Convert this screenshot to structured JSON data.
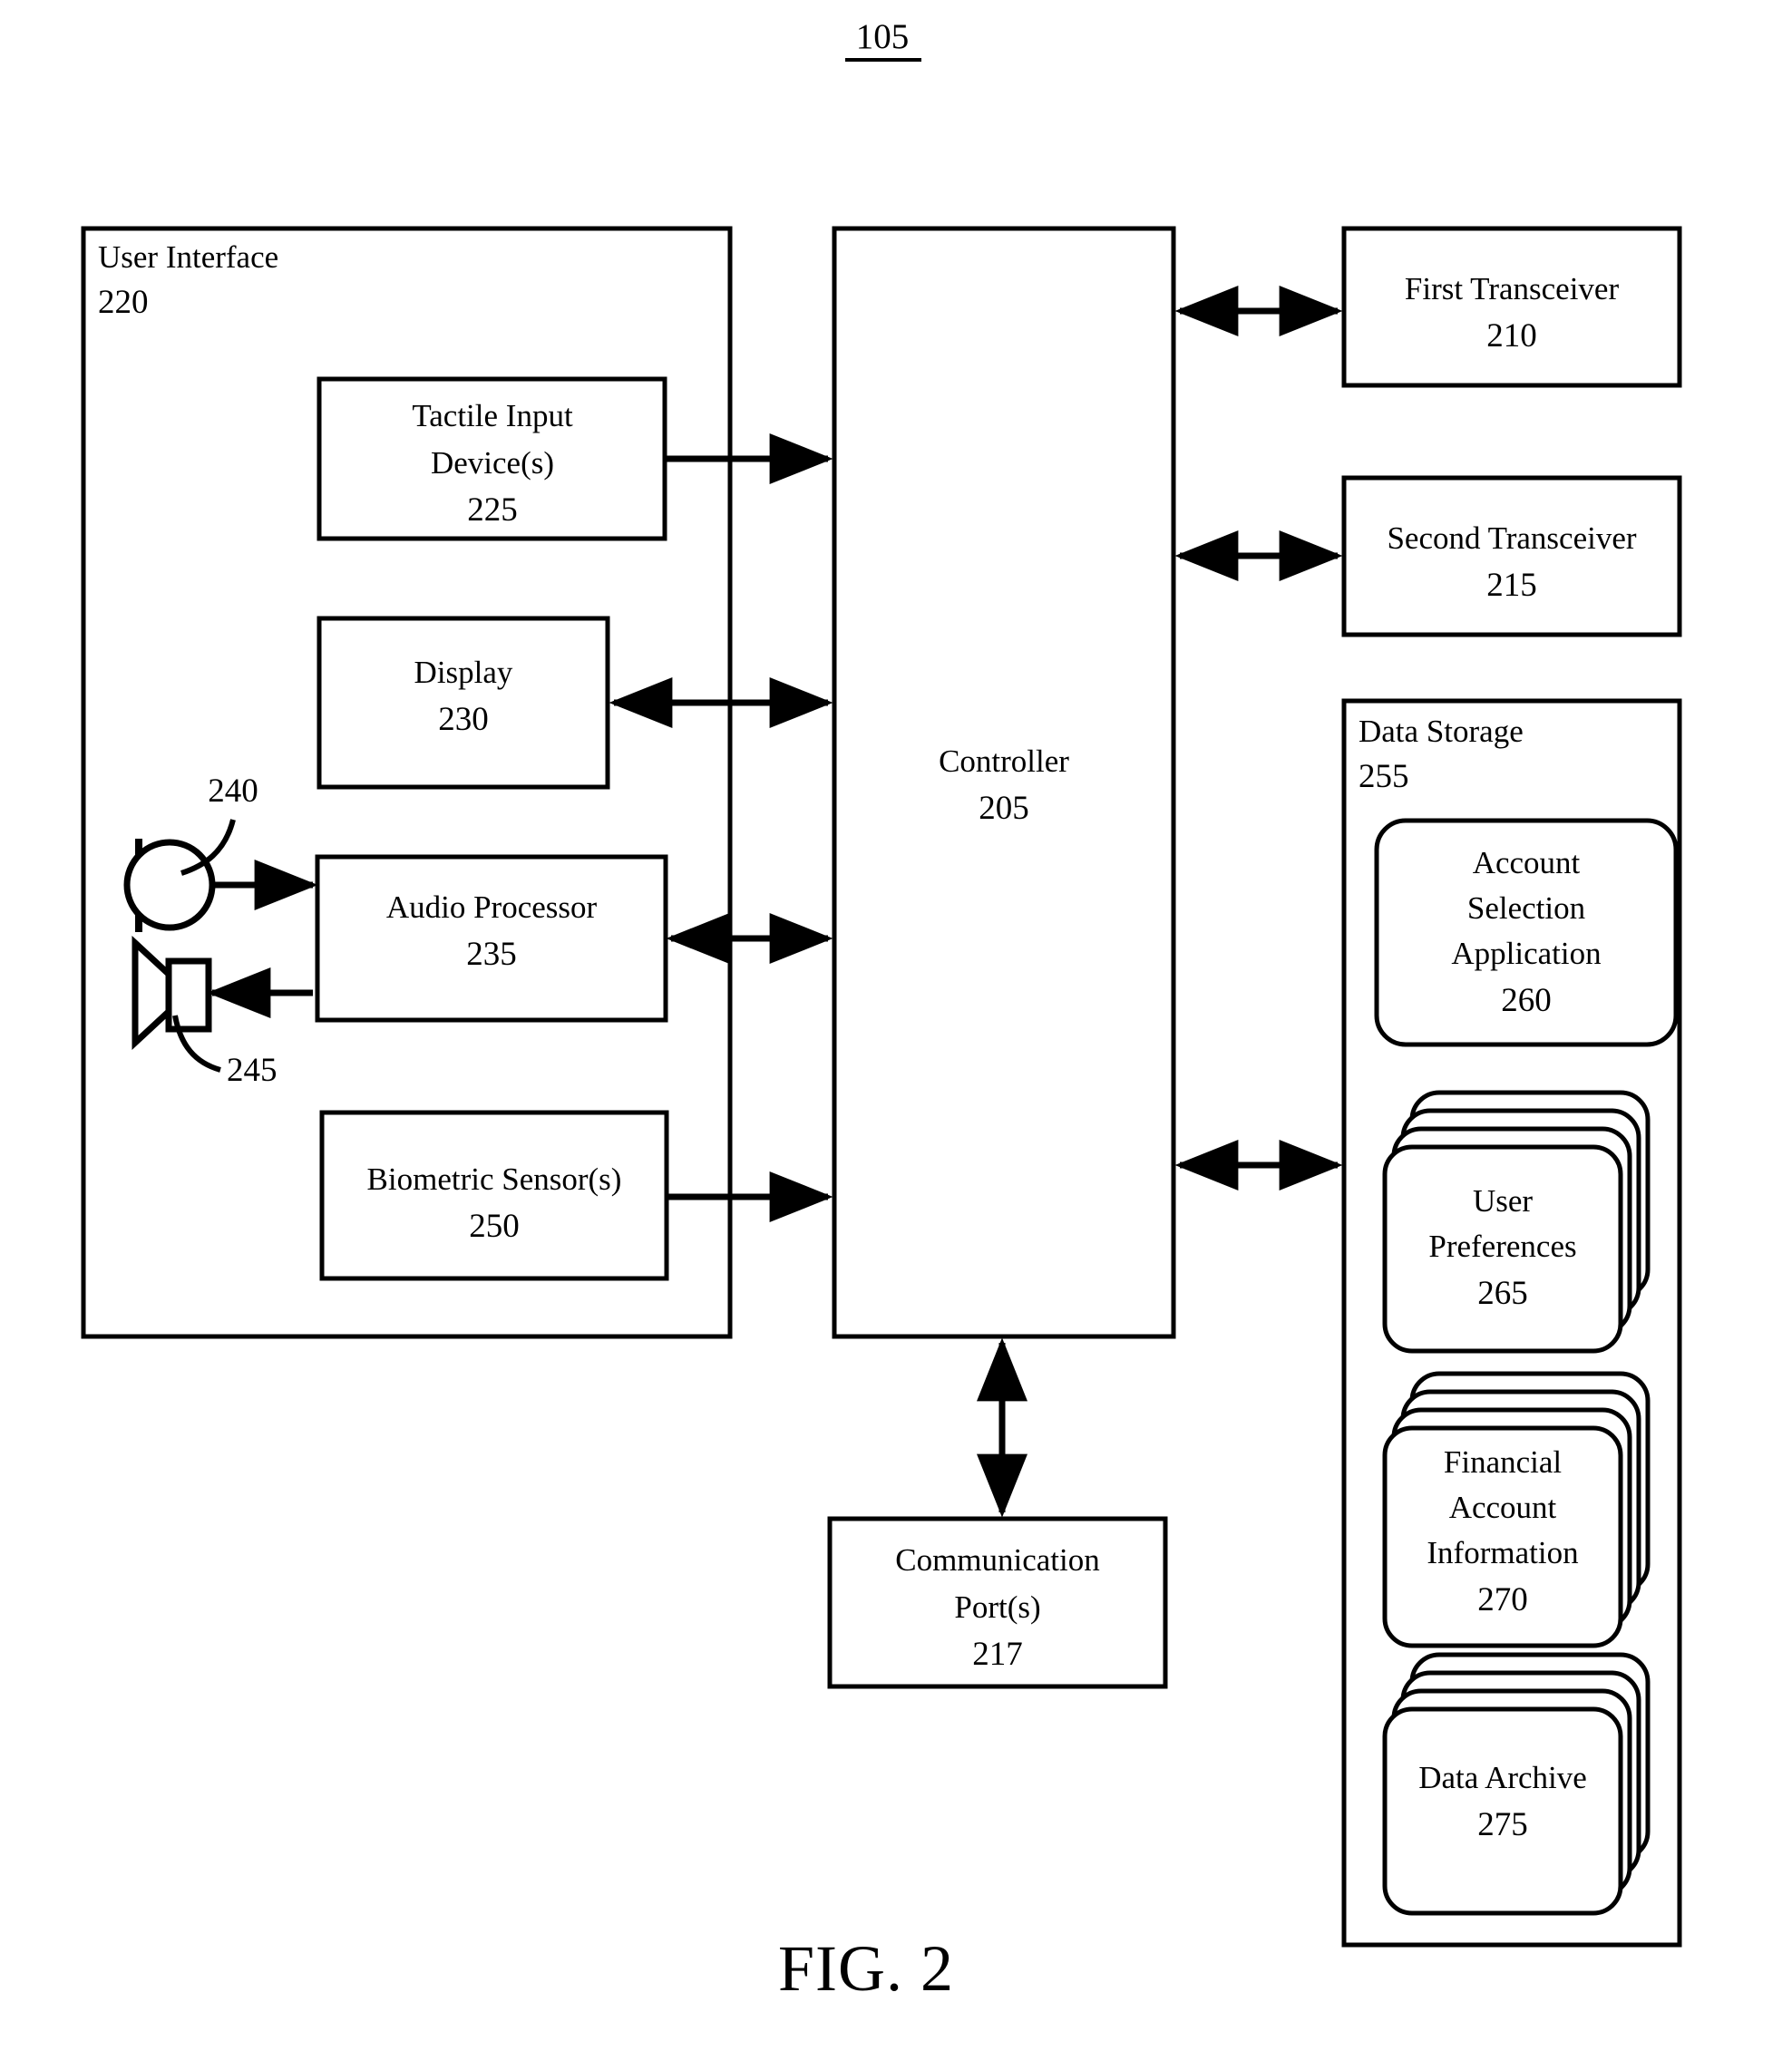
{
  "figure": {
    "top_reference": "105",
    "caption": "FIG. 2"
  },
  "blocks": {
    "user_interface": {
      "label": "User Interface",
      "ref": "220"
    },
    "tactile_input": {
      "line1": "Tactile Input",
      "line2": "Device(s)",
      "ref": "225"
    },
    "display": {
      "line1": "Display",
      "ref": "230"
    },
    "audio_processor": {
      "line1": "Audio Processor",
      "ref": "235"
    },
    "microphone": {
      "ref": "240"
    },
    "speaker": {
      "ref": "245"
    },
    "biometric_sensor": {
      "line1": "Biometric Sensor(s)",
      "ref": "250"
    },
    "controller": {
      "line1": "Controller",
      "ref": "205"
    },
    "first_transceiver": {
      "line1": "First Transceiver",
      "ref": "210"
    },
    "second_transceiver": {
      "line1": "Second Transceiver",
      "ref": "215"
    },
    "communication_port": {
      "line1": "Communication",
      "line2": "Port(s)",
      "ref": "217"
    },
    "data_storage": {
      "label": "Data Storage",
      "ref": "255"
    },
    "account_selection_application": {
      "line1": "Account",
      "line2": "Selection",
      "line3": "Application",
      "ref": "260"
    },
    "user_preferences": {
      "line1": "User",
      "line2": "Preferences",
      "ref": "265"
    },
    "financial_account_information": {
      "line1": "Financial",
      "line2": "Account",
      "line3": "Information",
      "ref": "270"
    },
    "data_archive": {
      "line1": "Data Archive",
      "ref": "275"
    }
  },
  "colors": {
    "stroke": "#000000",
    "fill": "#ffffff"
  }
}
